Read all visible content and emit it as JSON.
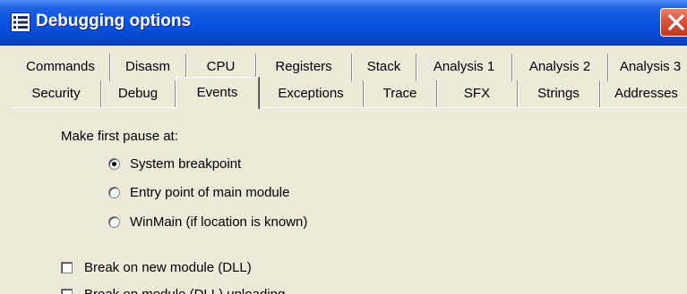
{
  "window": {
    "title": "Debugging options",
    "close_icon": "close-icon",
    "app_icon": "list-icon",
    "colors": {
      "titlebar": "#0a54e2",
      "close": "#d7533a",
      "face": "#ece9d8"
    }
  },
  "tabs": {
    "row1": [
      "Commands",
      "Disasm",
      "CPU",
      "Registers",
      "Stack",
      "Analysis 1",
      "Analysis 2",
      "Analysis 3"
    ],
    "row2": [
      "Security",
      "Debug",
      "Events",
      "Exceptions",
      "Trace",
      "SFX",
      "Strings",
      "Addresses"
    ],
    "active": "Events"
  },
  "events": {
    "pause_label": "Make first pause at:",
    "pause_options": [
      {
        "label": "System breakpoint",
        "selected": true
      },
      {
        "label": "Entry point of main module",
        "selected": false
      },
      {
        "label": "WinMain (if location is known)",
        "selected": false
      }
    ],
    "checkboxes": [
      {
        "label": "Break on new module (DLL)",
        "checked": false
      },
      {
        "label": "Break on module (DLL) unloading",
        "checked": false
      }
    ]
  }
}
